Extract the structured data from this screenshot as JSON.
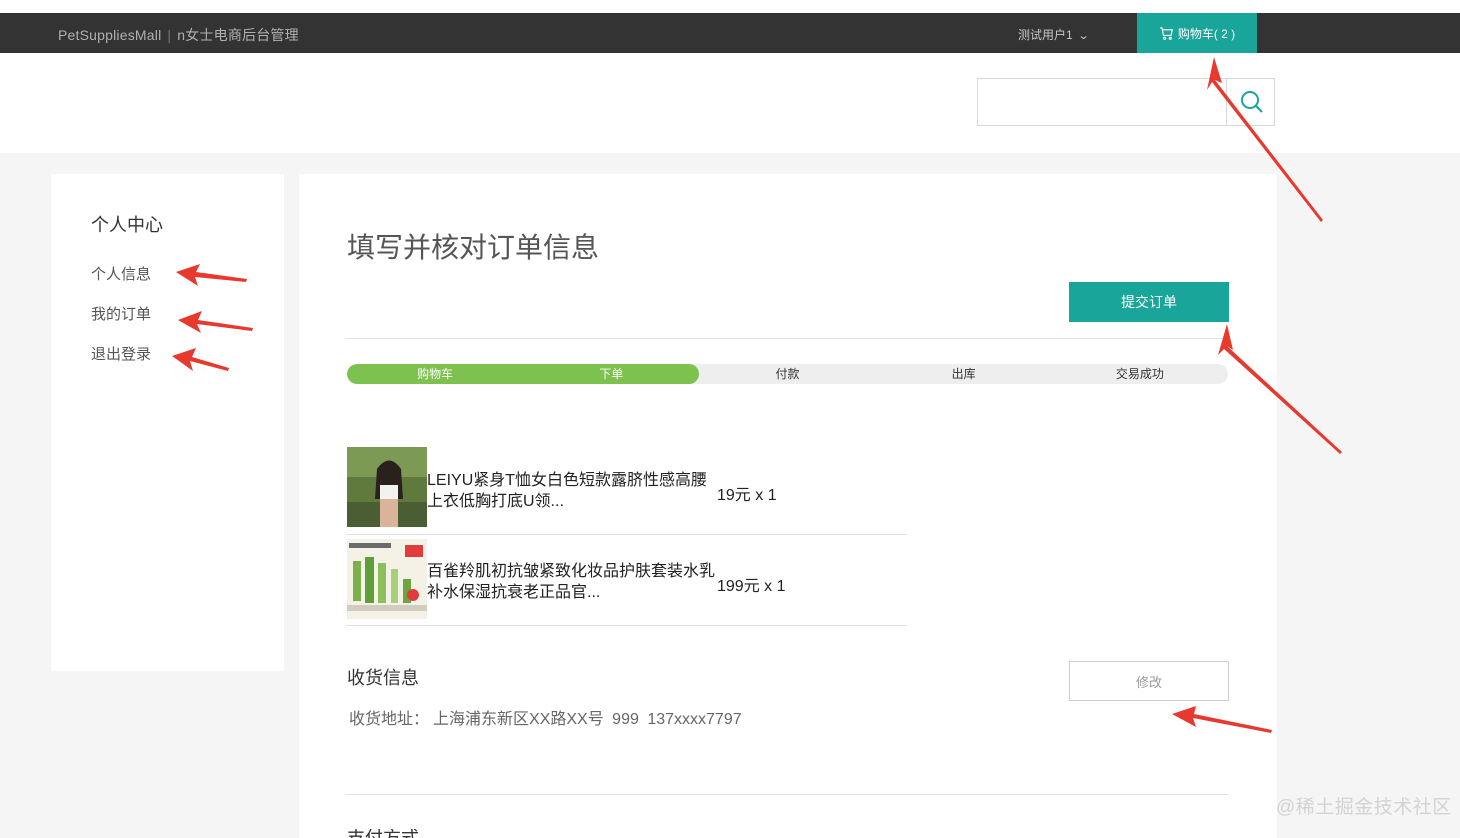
{
  "topbar": {
    "brand": "PetSuppliesMall",
    "separator": "|",
    "admin_link": "n女士电商后台管理",
    "user_menu": "测试用户1",
    "cart_label": "购物车( 2 )"
  },
  "search": {
    "value": "",
    "placeholder": ""
  },
  "sidebar": {
    "title": "个人中心",
    "items": [
      {
        "label": "个人信息"
      },
      {
        "label": "我的订单"
      },
      {
        "label": "退出登录"
      }
    ]
  },
  "main": {
    "title": "填写并核对订单信息",
    "submit_label": "提交订单",
    "progress": {
      "steps": [
        "购物车",
        "下单",
        "付款",
        "出库",
        "交易成功"
      ],
      "completed_steps": 2,
      "fill_color": "#7dc14e"
    },
    "items": [
      {
        "name": "LEIYU紧身T恤女白色短款露脐性感高腰上衣低胸打底U领...",
        "price": "19元 x 1",
        "image": "photo-woman-white-top"
      },
      {
        "name": "百雀羚肌初抗皱紧致化妆品护肤套装水乳补水保湿抗衰老正品官...",
        "price": "199元 x 1",
        "image": "product-skincare-set"
      }
    ],
    "shipping": {
      "title": "收货信息",
      "address_label": "收货地址：",
      "address": "上海浦东新区XX路XX号",
      "name": "999",
      "phone": "137xxxx7797",
      "edit_label": "修改"
    },
    "payment_title": "支付方式"
  },
  "watermark": "@稀土掘金技术社区",
  "colors": {
    "accent": "#1aa59a",
    "topbar_bg": "#333333",
    "annotation_arrow": "#e8392f"
  }
}
